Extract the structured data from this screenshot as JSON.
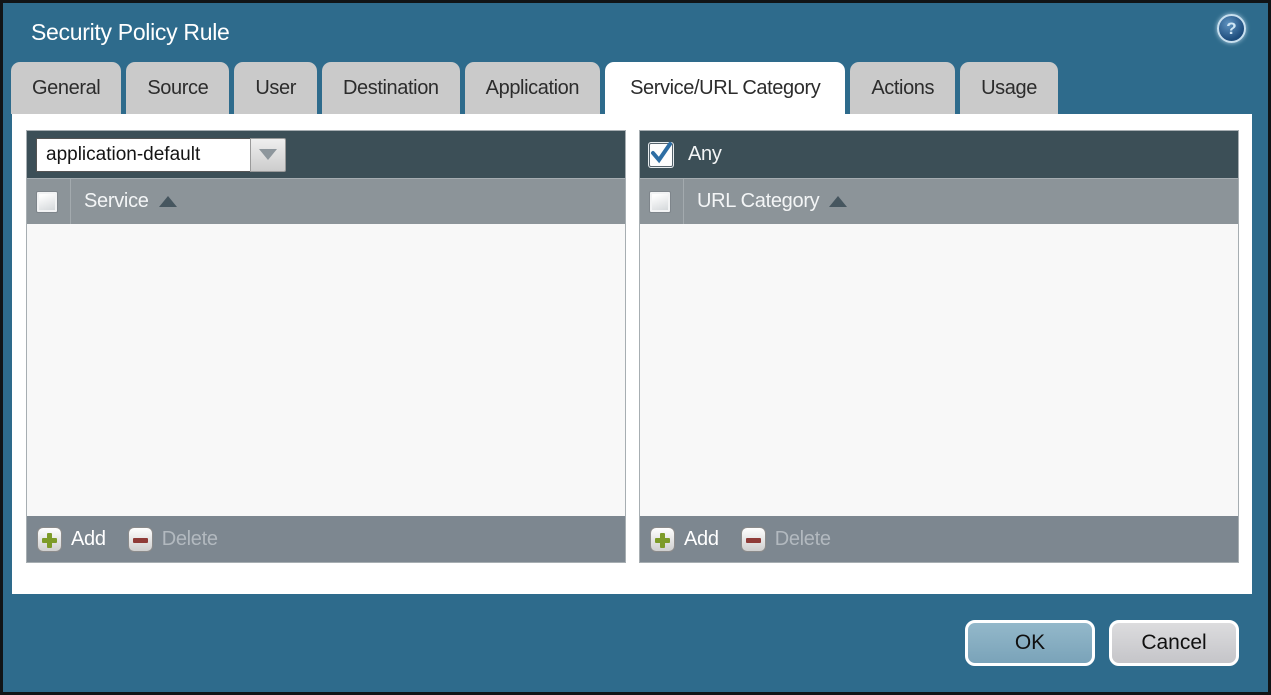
{
  "dialog": {
    "title": "Security Policy Rule"
  },
  "icons": {
    "help_glyph": "?"
  },
  "tabs": {
    "items": [
      {
        "label": "General",
        "active": false
      },
      {
        "label": "Source",
        "active": false
      },
      {
        "label": "User",
        "active": false
      },
      {
        "label": "Destination",
        "active": false
      },
      {
        "label": "Application",
        "active": false
      },
      {
        "label": "Service/URL Category",
        "active": true
      },
      {
        "label": "Actions",
        "active": false
      },
      {
        "label": "Usage",
        "active": false
      }
    ]
  },
  "service_panel": {
    "dropdown_value": "application-default",
    "column_header": "Service",
    "list_items": [],
    "footer": {
      "add_label": "Add",
      "delete_label": "Delete",
      "delete_disabled": true
    }
  },
  "url_category_panel": {
    "any_label": "Any",
    "any_checked": true,
    "column_header": "URL Category",
    "list_items": [],
    "footer": {
      "add_label": "Add",
      "delete_label": "Delete",
      "delete_disabled": true
    }
  },
  "actions": {
    "ok_label": "OK",
    "cancel_label": "Cancel"
  },
  "colors": {
    "background_teal": "#2e6b8c",
    "toolbar_dark": "#3c4f57",
    "header_gray": "#8c9499",
    "footer_gray": "#7d8790",
    "tab_inactive": "#cacaca",
    "tab_active": "#ffffff",
    "ok_button_blue": "#7aa3b9",
    "cancel_button_gray": "#c5c5c9",
    "add_plus_green": "#7d9b29",
    "delete_minus_red": "#8f3b38",
    "checkmark_blue": "#2d6da3"
  }
}
